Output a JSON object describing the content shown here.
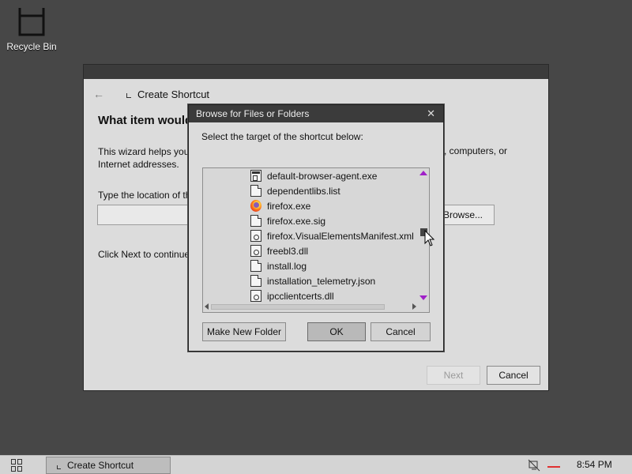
{
  "desktop": {
    "recycle_bin_label": "Recycle Bin",
    "recycle_bin_icon": "recycle-bin-icon"
  },
  "wizard": {
    "title": "Create Shortcut",
    "heading": "What item would",
    "description": "This wizard helps you\nInternet addresses.",
    "description_right": ", computers, or",
    "location_label": "Type the location of th",
    "location_value": "",
    "browse_label": "Browse...",
    "click_next_text": "Click Next to continue",
    "next_label": "Next",
    "cancel_label": "Cancel",
    "back_icon": "back-arrow-icon"
  },
  "dialog": {
    "title": "Browse for Files or Folders",
    "prompt": "Select the target of the shortcut below:",
    "files": [
      {
        "name": "default-browser-agent.exe",
        "icon": "exe-icon"
      },
      {
        "name": "dependentlibs.list",
        "icon": "file-icon"
      },
      {
        "name": "firefox.exe",
        "icon": "firefox-icon"
      },
      {
        "name": "firefox.exe.sig",
        "icon": "file-icon"
      },
      {
        "name": "firefox.VisualElementsManifest.xml",
        "icon": "dll-icon"
      },
      {
        "name": "freebl3.dll",
        "icon": "dll-icon"
      },
      {
        "name": "install.log",
        "icon": "file-icon"
      },
      {
        "name": "installation_telemetry.json",
        "icon": "file-icon"
      },
      {
        "name": "ipcclientcerts.dll",
        "icon": "dll-icon"
      }
    ],
    "make_new_folder_label": "Make New Folder",
    "ok_label": "OK",
    "cancel_label": "Cancel"
  },
  "taskbar": {
    "start_icon": "start-grid-icon",
    "task_item_label": "Create Shortcut",
    "clock": "8:54 PM",
    "network_icon": "network-disconnected-icon",
    "volume_icon": "volume-icon"
  },
  "colors": {
    "desktop_bg": "#474747",
    "window_bg": "#dcdcdc",
    "titlebar": "#3b3b3b",
    "scroll_arrow": "#a020c8"
  }
}
